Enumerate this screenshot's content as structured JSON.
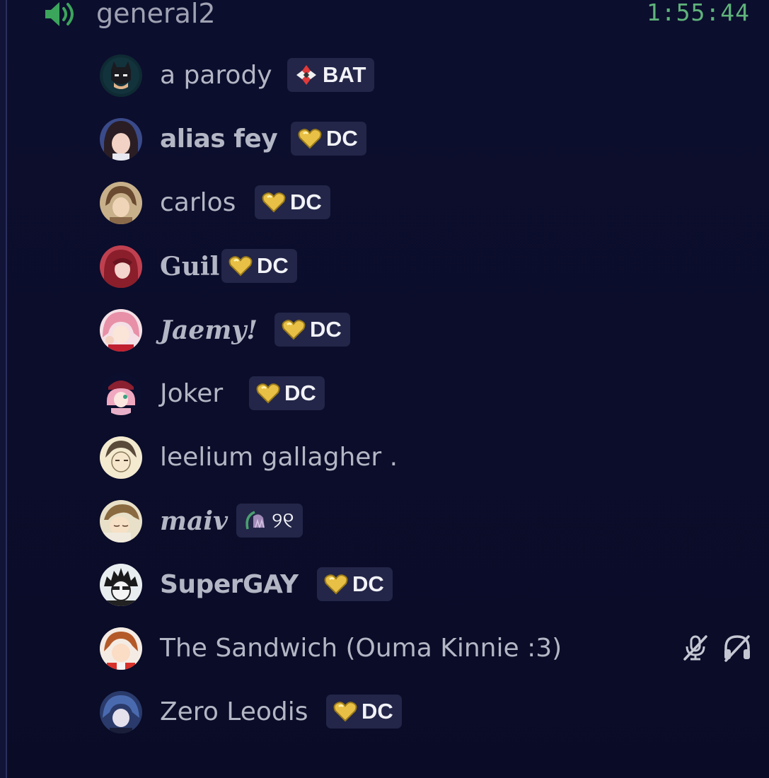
{
  "channel": {
    "name": "general2",
    "icon": "speaker-icon",
    "timer": "1:55:44",
    "accent_color": "#3ba55c"
  },
  "users": [
    {
      "name": "a parody",
      "tag": {
        "label": "BAT",
        "icon": "diamond-emblem-icon"
      },
      "style": "normal",
      "avatar": "batman-avatar"
    },
    {
      "name": "alias fey",
      "tag": {
        "label": "DC",
        "icon": "gold-heart-icon"
      },
      "style": "bold-rounded",
      "avatar": "anime-girl-avatar"
    },
    {
      "name": "carlos",
      "tag": {
        "label": "DC",
        "icon": "gold-heart-icon"
      },
      "style": "normal",
      "avatar": "brown-hair-avatar"
    },
    {
      "name": "Guil",
      "tag": {
        "label": "DC",
        "icon": "gold-heart-icon"
      },
      "style": "serif-bold",
      "avatar": "red-hair-avatar"
    },
    {
      "name": "Jaemy!",
      "tag": {
        "label": "DC",
        "icon": "gold-heart-icon"
      },
      "style": "serif-italic",
      "avatar": "pink-hair-avatar"
    },
    {
      "name": "Joker",
      "tag": {
        "label": "DC",
        "icon": "gold-heart-icon"
      },
      "style": "normal",
      "avatar": "pink-cap-avatar"
    },
    {
      "name": "leelium gallagher .",
      "tag": null,
      "style": "normal",
      "avatar": "sketch-avatar"
    },
    {
      "name": "maiv",
      "tag": {
        "label": "୨୧",
        "icon": "bell-flower-icon"
      },
      "style": "serif-italic",
      "avatar": "sleeping-avatar"
    },
    {
      "name": "SuperGAY",
      "tag": {
        "label": "DC",
        "icon": "gold-heart-icon"
      },
      "style": "bold-rounded",
      "avatar": "dark-hair-avatar"
    },
    {
      "name": "The Sandwich (Ouma Kinnie :3)",
      "tag": null,
      "style": "normal",
      "avatar": "ginger-avatar",
      "muted": true,
      "deafened": true
    },
    {
      "name": "Zero Leodis",
      "tag": {
        "label": "DC",
        "icon": "gold-heart-icon"
      },
      "style": "normal",
      "avatar": "blue-hair-avatar"
    }
  ]
}
